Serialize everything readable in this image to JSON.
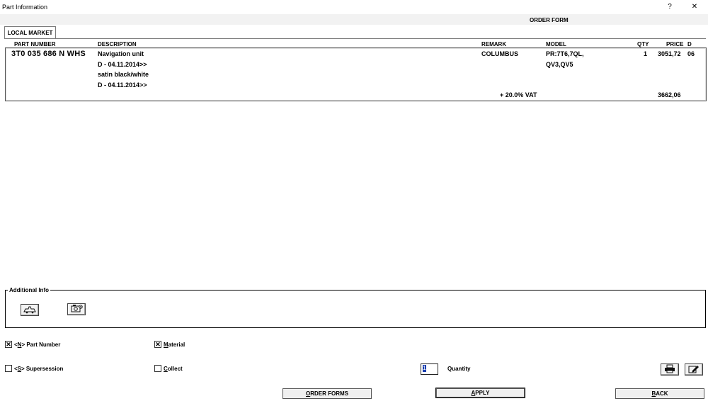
{
  "window": {
    "title": "Part Information",
    "help": "?",
    "close": "✕"
  },
  "header": {
    "order_form": "ORDER FORM"
  },
  "tabs": [
    {
      "label": "LOCAL MARKET"
    }
  ],
  "columns": {
    "part_number": "PART NUMBER",
    "description": "DESCRIPTION",
    "remark": "REMARK",
    "model": "MODEL",
    "qty": "QTY",
    "price": "PRICE",
    "d": "D"
  },
  "row": {
    "part_number": "3T0 035 686 N  WHS",
    "description": [
      "Navigation unit",
      "D - 04.11.2014>>",
      "satin black/white",
      "D - 04.11.2014>>"
    ],
    "remark": "COLUMBUS",
    "model": [
      "PR:7T6,7QL,",
      "QV3,QV5"
    ],
    "qty": "1",
    "price": "3051,72",
    "d": "06",
    "vat_label": "+ 20.0% VAT",
    "vat_total": "3662,06"
  },
  "additional_info": {
    "label": "Additional Info"
  },
  "options": {
    "part_number": {
      "prefix": "<",
      "key": "N",
      "suffix": "> Part Number",
      "checked": true
    },
    "supersession": {
      "prefix": "<",
      "key": "S",
      "suffix": "> Supersession",
      "checked": false
    },
    "material": {
      "key": "M",
      "rest": "aterial",
      "checked": true
    },
    "collect": {
      "key": "C",
      "rest": "ollect",
      "checked": false
    }
  },
  "quantity": {
    "label": "Quantity",
    "value": "1"
  },
  "buttons": {
    "order_forms": {
      "key": "O",
      "rest": "RDER FORMS"
    },
    "apply": {
      "key": "A",
      "rest": "PPLY"
    },
    "back": {
      "key": "B",
      "rest": "ACK"
    }
  },
  "icons": {
    "vehicle": "vehicle-icon",
    "camera": "camera-icon",
    "print": "print-icon",
    "edit": "edit-icon"
  }
}
